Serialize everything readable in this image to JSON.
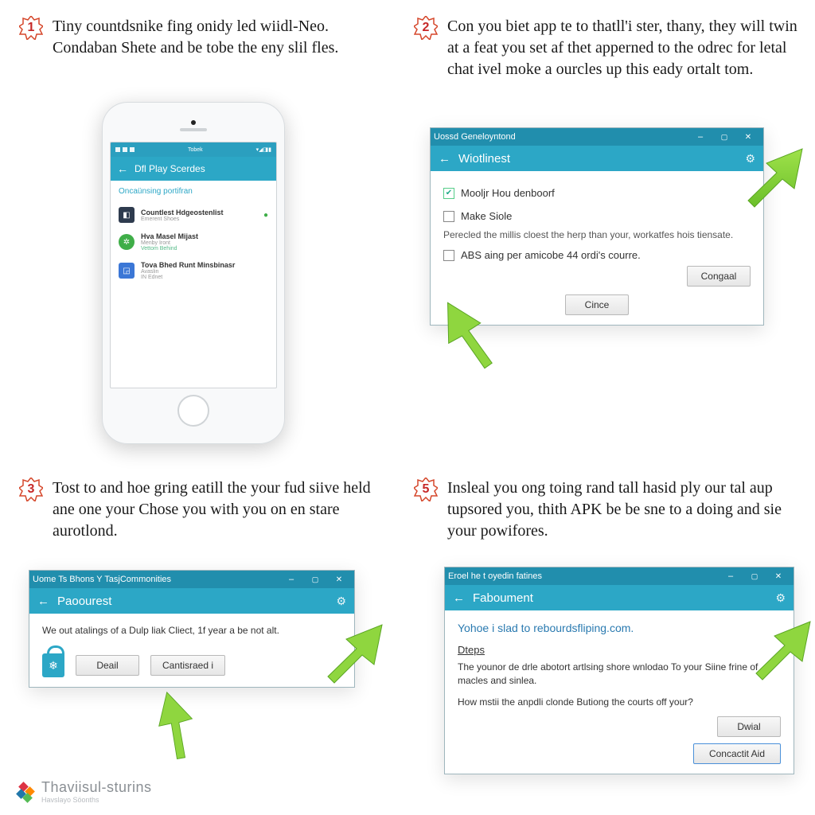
{
  "steps": {
    "s1": {
      "num": "1",
      "text": "Tiny countdsnike fing onidy led wiidl-Neo. Condaban Shete and be tobe the eny slil fles."
    },
    "s2": {
      "num": "2",
      "text": "Con you biet app te to thatll'i ster, thany, they will twin at a feat you set af thet apperned to the odrec for letal chat ivel moke a ourcles up this eady ortalt tom."
    },
    "s3": {
      "num": "3",
      "text": "Tost to and hoe gring eatill the your fud siive held ane one your Chose you with you on en stare aurotlond."
    },
    "s5": {
      "num": "5",
      "text": "Insleal you ong toing rand tall hasid ply our tal aup tupsored you, thith APK be be sne to a doing and sie your powifores."
    }
  },
  "phone": {
    "status_left": "◼ ◼ ◼",
    "status_mid": "Tobek",
    "status_right": "▾◢◨▮",
    "appbar_title": "Dfl Play Scerdes",
    "section": "Oncaünsing portifran",
    "items": [
      {
        "title": "Countlest Hdgeostenlist",
        "sub": "Emerent Shoes"
      },
      {
        "title": "Hva Masel Mijast",
        "sub": "Menby Iront",
        "sub2": "Vettom Behind"
      },
      {
        "title": "Tova Bhed Runt Minsbinasr",
        "sub": "Avaslin",
        "sub2": "IN Ednet"
      }
    ]
  },
  "dlg2": {
    "title": "Uossd Geneloyntond",
    "sub": "Wiotlinest",
    "chk1": "Mooljr Hou denboorf",
    "chk2": "Make Siole",
    "desc": "Perecled the millis cloest the herp than your, workatfes hois tiensate.",
    "chk3": "ABS aing per amicobe 44 ordi's courre.",
    "btn1": "Congaal",
    "btn2": "Cince"
  },
  "dlg3": {
    "title": "Uome Ts Bhons Y TasjCommonities",
    "sub": "Paoourest",
    "body": "We out atalings of a Dulp liak Cliect, 1f year a be not alt.",
    "btn1": "Deail",
    "btn2": "Cantisraed i"
  },
  "dlg5": {
    "title": "Eroel he t oyedin fatines",
    "sub": "Faboument",
    "headline": "Yohoe i slad to rebourdsfliping.com.",
    "section": "Dteps",
    "p1": "The younor de drle abotort artlsing shore wnlodao To your Siine frine of macles and sinlea.",
    "p2": "How mstii the anpdli clonde Butiong the courts off your?",
    "btn1": "Dwial",
    "btn2": "Concactit Aid"
  },
  "watermark": {
    "line1": "Thaviisul-sturins",
    "line2": "Havslayo Söonths"
  }
}
